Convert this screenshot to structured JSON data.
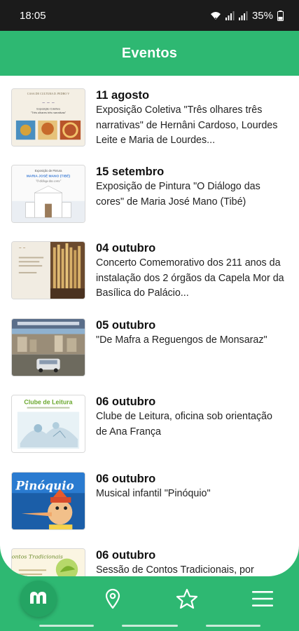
{
  "status_bar": {
    "time": "18:05",
    "battery": "35%",
    "icons": [
      "wifi-icon",
      "signal-icon",
      "signal-icon",
      "battery-icon"
    ]
  },
  "header": {
    "title": "Eventos"
  },
  "events": [
    {
      "date": "11 agosto",
      "description": "Exposição Coletiva \"Três olhares três narrativas\" de Hernâni Cardoso, Lourdes Leite e Maria de Lourdes..."
    },
    {
      "date": "15 setembro",
      "description": "Exposição de Pintura \"O Diálogo das cores\" de Maria José Mano (Tibé)"
    },
    {
      "date": "04 outubro",
      "description": "Concerto Comemorativo dos 211 anos da instalação dos 2 órgãos da Capela Mor da Basílica do Palácio..."
    },
    {
      "date": "05 outubro",
      "description": "\"De Mafra a Reguengos de Monsaraz\""
    },
    {
      "date": "06 outubro",
      "description": "Clube de Leitura, oficina sob orientação de Ana França"
    },
    {
      "date": "06 outubro",
      "description": "Musical infantil \"Pinóquio\""
    },
    {
      "date": "06 outubro",
      "description": "Sessão de Contos Tradicionais, por"
    }
  ],
  "thumbnails": {
    "event_1": {
      "lines": [
        "CASA DE CULTURA D. PEDRO V",
        "Exposição Coletiva",
        "\"Três olhares três narrativas\""
      ]
    },
    "event_2": {
      "lines": [
        "Exposição de Pintura",
        "MARIA JOSÉ MANO (TIBÉ)",
        "\"O diálogo das cores\""
      ]
    },
    "event_5": {
      "title": "Clube de Leitura"
    },
    "event_6": {
      "title": "Pinóquio"
    },
    "event_7": {
      "title": "Contos Tradicionais"
    }
  },
  "nav": {
    "items": [
      "home-logo-icon",
      "map-pin-icon",
      "star-icon",
      "menu-icon"
    ]
  },
  "colors": {
    "primary": "#2eb872",
    "primary_dark": "#24a463",
    "status_bar": "#1b1b1b",
    "text": "#222222"
  }
}
